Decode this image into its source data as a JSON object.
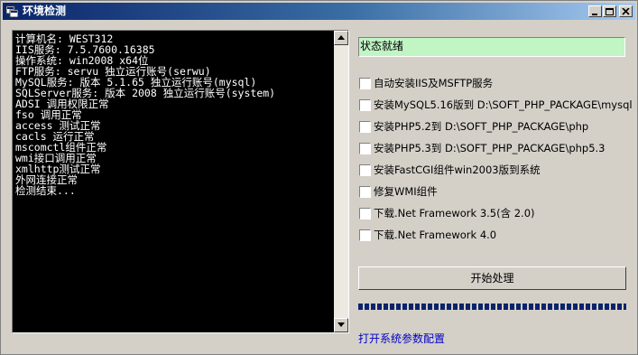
{
  "window": {
    "title": "环境检测",
    "controls": [
      "minimize-icon",
      "maximize-icon",
      "close-icon"
    ]
  },
  "console": {
    "lines": [
      "计算机名: WEST312",
      "IIS服务: 7.5.7600.16385",
      "操作系统: win2008 x64位",
      "FTP服务: servu 独立运行账号(serwu)",
      "MySQL服务: 版本 5.1.65 独立运行账号(mysql)",
      "SQLServer服务: 版本 2008 独立运行账号(system)",
      "ADSI 调用权限正常",
      "fso 调用正常",
      "access 测试正常",
      "cacls 运行正常",
      "mscomctl组件正常",
      "wmi接口调用正常",
      "xmlhttp测试正常",
      "外网连接正常",
      "检测结束..."
    ]
  },
  "status": {
    "text": "状态就绪",
    "color": "#c1f5c4"
  },
  "options": [
    {
      "label": "自动安装IIS及MSFTP服务",
      "checked": false
    },
    {
      "label": "安装MySQL5.16版到 D:\\SOFT_PHP_PACKAGE\\mysql",
      "checked": false
    },
    {
      "label": "安装PHP5.2到 D:\\SOFT_PHP_PACKAGE\\php",
      "checked": false
    },
    {
      "label": "安装PHP5.3到 D:\\SOFT_PHP_PACKAGE\\php5.3",
      "checked": false
    },
    {
      "label": "安装FastCGI组件win2003版到系统",
      "checked": false
    },
    {
      "label": "修复WMI组件",
      "checked": false
    },
    {
      "label": "下载.Net Framework 3.5(含 2.0)",
      "checked": false
    },
    {
      "label": "下载.Net Framework 4.0",
      "checked": false
    }
  ],
  "actions": {
    "start_label": "开始处理",
    "config_link": "打开系统参数配置"
  },
  "progress": {
    "fraction": 1.0,
    "color": "#0a246a"
  }
}
